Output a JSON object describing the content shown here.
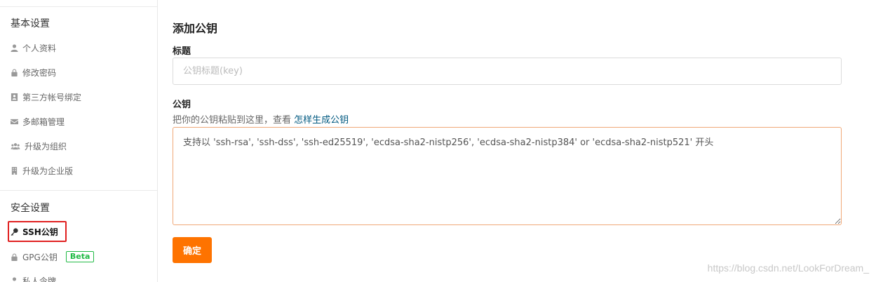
{
  "sidebar": {
    "basic_section_title": "基本设置",
    "basic_items": [
      {
        "label": "个人资料",
        "icon": "user-icon"
      },
      {
        "label": "修改密码",
        "icon": "lock-icon"
      },
      {
        "label": "第三方帐号绑定",
        "icon": "account-card-icon"
      },
      {
        "label": "多邮箱管理",
        "icon": "envelope-icon"
      },
      {
        "label": "升级为组织",
        "icon": "users-icon"
      },
      {
        "label": "升级为企业版",
        "icon": "building-icon"
      }
    ],
    "security_section_title": "安全设置",
    "security_items": [
      {
        "label": "SSH公钥",
        "icon": "key-icon",
        "active": true
      },
      {
        "label": "GPG公钥",
        "icon": "lock-icon",
        "badge": "Beta"
      },
      {
        "label": "私人令牌",
        "icon": "user-icon"
      }
    ]
  },
  "form": {
    "title": "添加公钥",
    "title_field_label": "标题",
    "title_field_placeholder": "公钥标题(key)",
    "title_field_value": "",
    "key_field_label": "公钥",
    "key_hint_text": "把你的公钥粘贴到这里，查看 ",
    "key_hint_link": "怎样生成公钥",
    "key_field_placeholder": "支持以 'ssh-rsa', 'ssh-dss', 'ssh-ed25519', 'ecdsa-sha2-nistp256', 'ecdsa-sha2-nistp384' or 'ecdsa-sha2-nistp521' 开头",
    "key_field_value": "",
    "submit_label": "确定"
  },
  "watermark": "https://blog.csdn.net/LookForDream_",
  "colors": {
    "accent": "#fe7300",
    "link": "#005980",
    "beta_badge": "#21ba45",
    "highlight_box": "#e02020"
  }
}
